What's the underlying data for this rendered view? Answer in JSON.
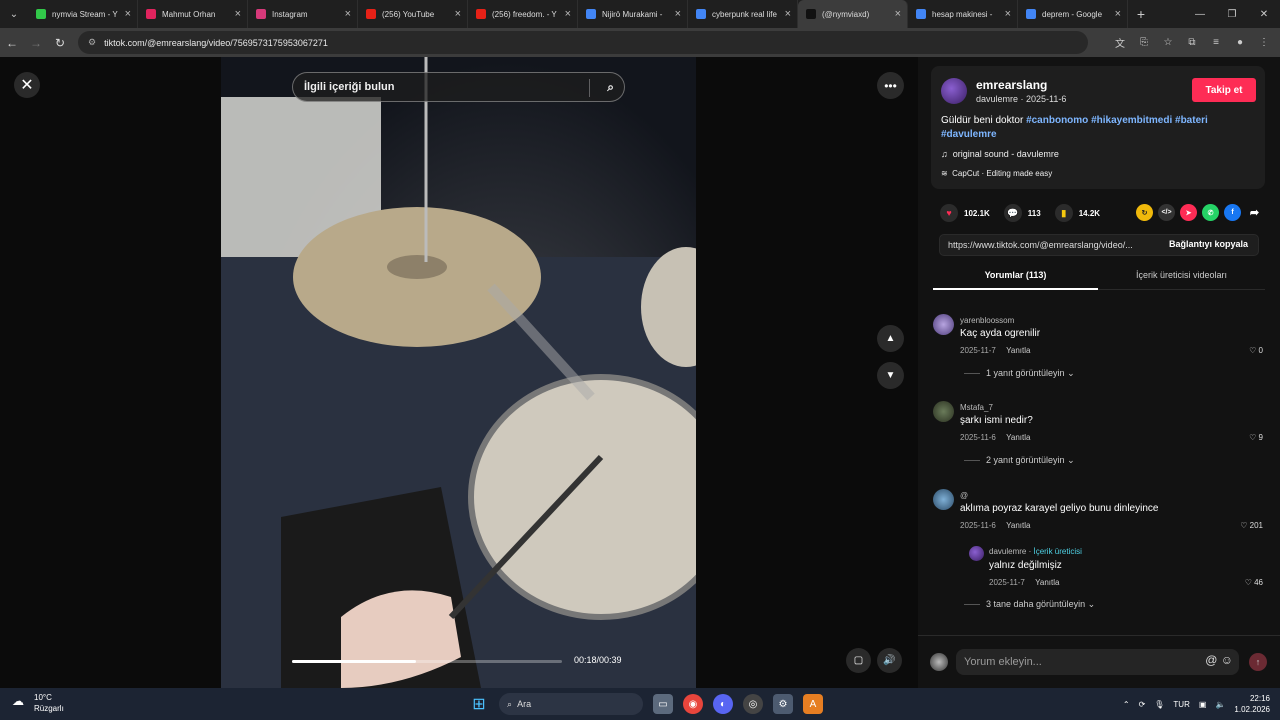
{
  "browser": {
    "tabs": [
      {
        "title": "nymvia Stream - Y",
        "color": "#32c84a"
      },
      {
        "title": "Mahmut Orhan",
        "color": "#e0245e"
      },
      {
        "title": "Instagram",
        "color": "#d6397a"
      },
      {
        "title": "(256) YouTube",
        "color": "#e62117"
      },
      {
        "title": "(256) freedom. - Y",
        "color": "#e62117"
      },
      {
        "title": "Nijirō Murakami -",
        "color": "#4285f4"
      },
      {
        "title": "cyberpunk real life",
        "color": "#4285f4"
      },
      {
        "title": "(@nymviaxd)",
        "color": "#111111"
      },
      {
        "title": "hesap makinesi -",
        "color": "#4285f4"
      },
      {
        "title": "deprem - Google",
        "color": "#4285f4"
      }
    ],
    "url": "tiktok.com/@emrearslang/video/7569573175953067271"
  },
  "player": {
    "search_placeholder": "İlgili içeriği bulun",
    "time": "00:18/00:39",
    "progress": 0.46
  },
  "post": {
    "author": "emrearslang",
    "author_sub": "davulemre · 2025-11-6",
    "follow_label": "Takip et",
    "desc_text": "Güldür beni doktor",
    "hashtags": [
      "#canbonomo",
      "#hikayembitmedi",
      "#bateri",
      "#davulemre"
    ],
    "sound": "original sound - davulemre",
    "capcut": "CapCut · Editing made easy",
    "likes": "102.1K",
    "comments": "113",
    "saves": "14.2K",
    "link": "https://www.tiktok.com/@emrearslang/video/...",
    "copy_label": "Bağlantıyı kopyala",
    "tab_comments": "Yorumlar (113)",
    "tab_creator": "İçerik üreticisi videoları"
  },
  "comments": [
    {
      "user": "yarenbloossom",
      "text": "Kaç ayda ogrenilir",
      "date": "2025-11-7",
      "reply": "Yanıtla",
      "likes": "0",
      "more": "1 yanıt görüntüleyin"
    },
    {
      "user": "Mstafa_7",
      "text": "şarkı ismi nedir?",
      "date": "2025-11-6",
      "reply": "Yanıtla",
      "likes": "9",
      "more": "2 yanıt görüntüleyin"
    },
    {
      "user": "@",
      "text": "aklıma poyraz karayel geliyo bunu dinleyince",
      "date": "2025-11-6",
      "reply": "Yanıtla",
      "likes": "201",
      "more": "3 tane daha görüntüleyin"
    }
  ],
  "reply": {
    "user": "davulemre",
    "badge": "İçerik üreticisi",
    "text": "yalnız değilmişiz",
    "date": "2025-11-7",
    "reply": "Yanıtla",
    "likes": "46"
  },
  "compose_placeholder": "Yorum ekleyin...",
  "taskbar": {
    "temp": "10°C",
    "weather": "Rüzgarlı",
    "search": "Ara",
    "lang": "TUR",
    "time": "22:16",
    "date": "1.02.2026"
  }
}
